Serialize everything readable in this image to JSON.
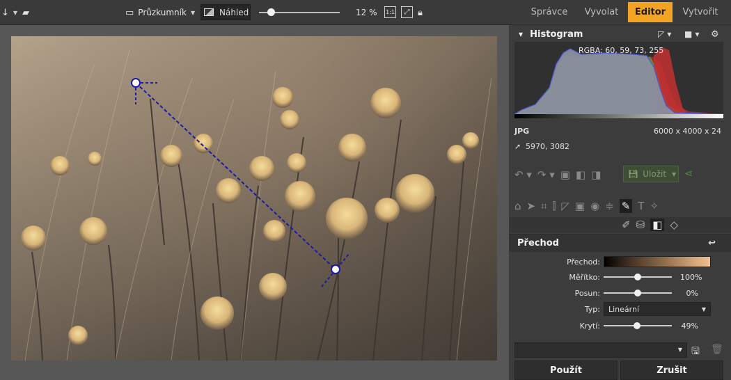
{
  "toolbar": {
    "browser_label": "Průzkumník",
    "preview_label": "Náhled",
    "zoom": "12 %",
    "actual_size_label": "1:1"
  },
  "modes": {
    "manager": "Správce",
    "develop": "Vyvolat",
    "editor": "Editor",
    "create": "Vytvořit"
  },
  "histogram": {
    "title": "Histogram",
    "rgba": "RGBA: 60, 59, 73, 255",
    "format": "JPG",
    "dimensions": "6000 x 4000 x 24",
    "cursor_pos": "5970, 3082"
  },
  "save": {
    "label": "Uložit"
  },
  "gradient_panel": {
    "title": "Přechod",
    "gradient_label": "Přechod:",
    "scale_label": "Měřítko:",
    "scale_value": "100%",
    "scale_fraction": 0.5,
    "offset_label": "Posun:",
    "offset_value": "0%",
    "offset_fraction": 0.5,
    "type_label": "Typ:",
    "type_value": "Lineární",
    "opacity_label": "Krytí:",
    "opacity_value": "49%",
    "opacity_fraction": 0.49
  },
  "buttons": {
    "apply": "Použít",
    "cancel": "Zrušit"
  },
  "colors": {
    "accent": "#f2a422",
    "save_green": "#4f8a3a"
  }
}
